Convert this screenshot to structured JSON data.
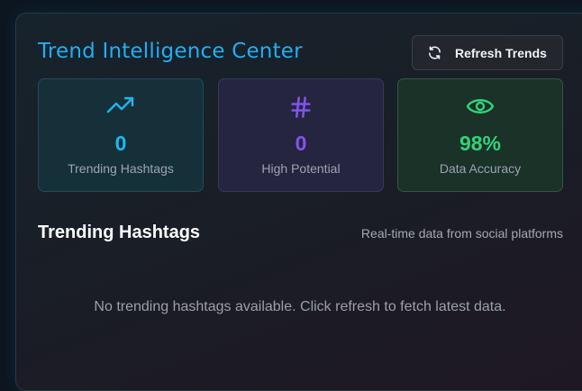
{
  "header": {
    "title": "Trend Intelligence Center",
    "refresh_label": "Refresh Trends",
    "refresh_icon": "refresh-icon"
  },
  "stats": [
    {
      "icon": "trending-up-icon",
      "value": "0",
      "label": "Trending Hashtags",
      "color": "#1fb6f0"
    },
    {
      "icon": "hash-icon",
      "value": "0",
      "label": "High Potential",
      "color": "#8055e8"
    },
    {
      "icon": "eye-icon",
      "value": "98%",
      "label": "Data Accuracy",
      "color": "#33d27a"
    }
  ],
  "section": {
    "title": "Trending Hashtags",
    "subtitle": "Real-time data from social platforms",
    "empty_message": "No trending hashtags available. Click refresh to fetch latest data."
  }
}
